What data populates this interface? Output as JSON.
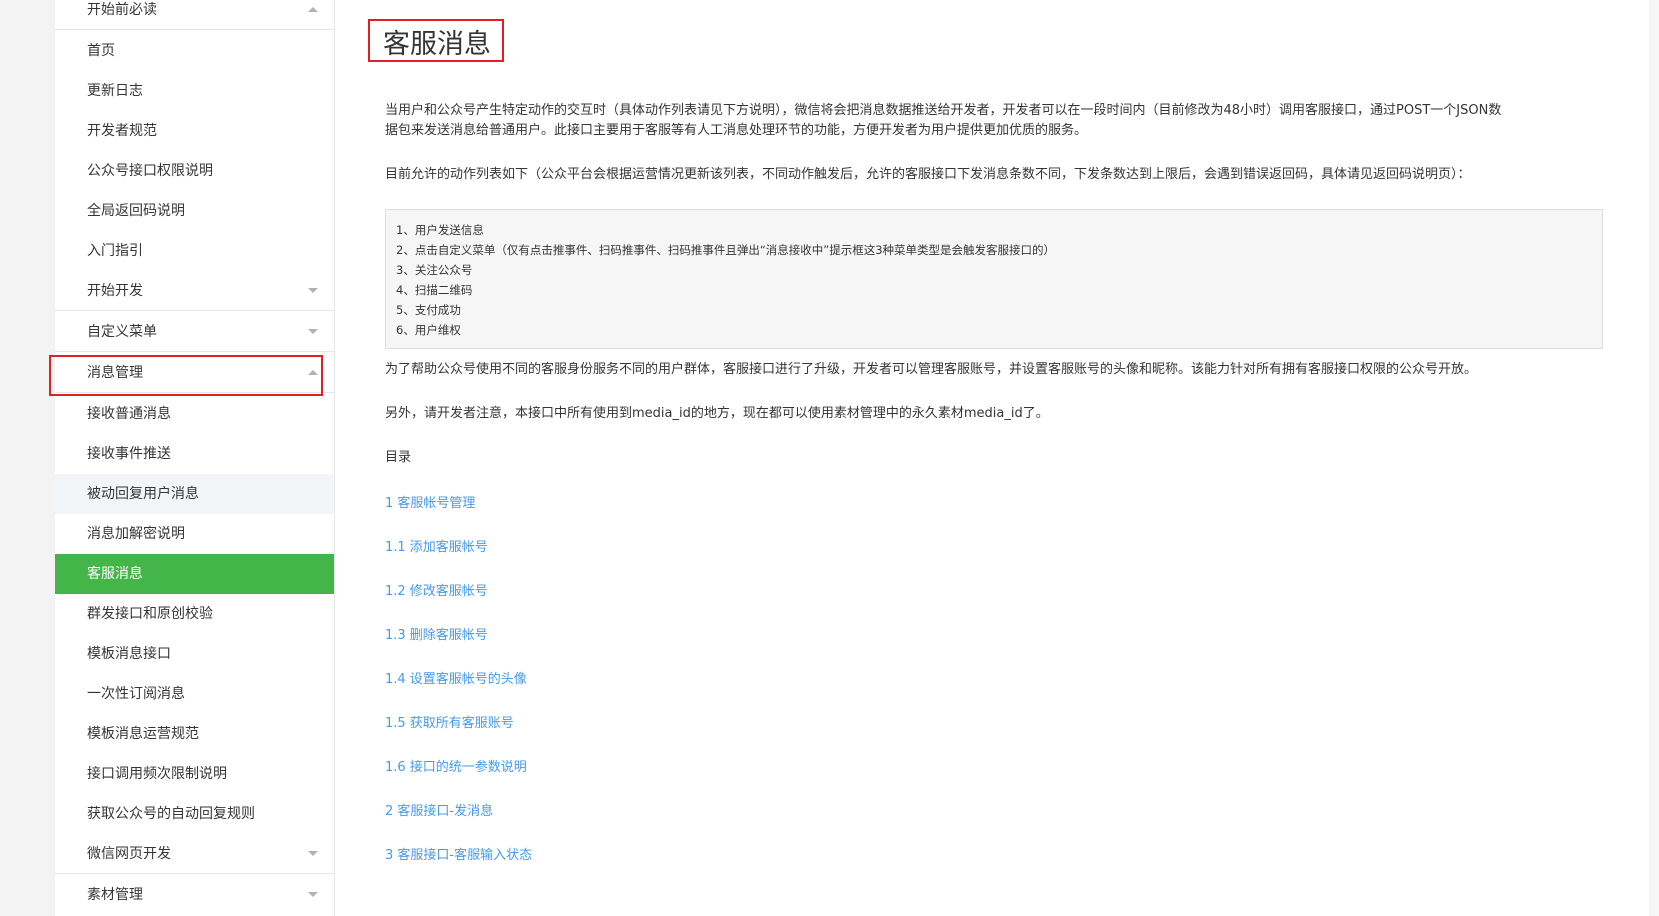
{
  "sidebar": {
    "items": [
      {
        "label": "开始前必读",
        "caret": "up"
      },
      {
        "label": "首页"
      },
      {
        "label": "更新日志"
      },
      {
        "label": "开发者规范"
      },
      {
        "label": "公众号接口权限说明"
      },
      {
        "label": "全局返回码说明"
      },
      {
        "label": "入门指引"
      },
      {
        "label": "开始开发",
        "caret": "down"
      },
      {
        "label": "自定义菜单",
        "caret": "down"
      },
      {
        "label": "消息管理",
        "caret": "up"
      },
      {
        "label": "接收普通消息"
      },
      {
        "label": "接收事件推送"
      },
      {
        "label": "被动回复用户消息"
      },
      {
        "label": "消息加解密说明"
      },
      {
        "label": "客服消息"
      },
      {
        "label": "群发接口和原创校验"
      },
      {
        "label": "模板消息接口"
      },
      {
        "label": "一次性订阅消息"
      },
      {
        "label": "模板消息运营规范"
      },
      {
        "label": "接口调用频次限制说明"
      },
      {
        "label": "获取公众号的自动回复规则"
      },
      {
        "label": "微信网页开发",
        "caret": "down"
      },
      {
        "label": "素材管理",
        "caret": "down"
      }
    ],
    "active_color": "#44b549"
  },
  "main": {
    "title": "客服消息",
    "intro_line1": "当用户和公众号产生特定动作的交互时（具体动作列表请见下方说明），微信将会把消息数据推送给开发者，开发者可以在一段时间内（目前修改为48小时）调用客服接口，通过POST一个JSON数",
    "intro_line2": "据包来发送消息给普通用户。此接口主要用于客服等有人工消息处理环节的功能，方便开发者为用户提供更加优质的服务。",
    "allowed_actions_intro": "目前允许的动作列表如下（公众平台会根据运营情况更新该列表，不同动作触发后，允许的客服接口下发消息条数不同，下发条数达到上限后，会遇到错误返回码，具体请见返回码说明页）：",
    "actions": [
      "1、用户发送信息",
      "2、点击自定义菜单（仅有点击推事件、扫码推事件、扫码推事件且弹出“消息接收中”提示框这3种菜单类型是会触发客服接口的）",
      "3、关注公众号",
      "4、扫描二维码",
      "5、支付成功",
      "6、用户维权"
    ],
    "upgrade_note": "为了帮助公众号使用不同的客服身份服务不同的用户群体，客服接口进行了升级，开发者可以管理客服账号，并设置客服账号的头像和昵称。该能力针对所有拥有客服接口权限的公众号开放。",
    "media_note": "另外，请开发者注意，本接口中所有使用到media_id的地方，现在都可以使用素材管理中的永久素材media_id了。",
    "toc_heading": "目录",
    "toc": [
      "1 客服帐号管理",
      "1.1 添加客服帐号",
      "1.2 修改客服帐号",
      "1.3 删除客服帐号",
      "1.4 设置客服帐号的头像",
      "1.5 获取所有客服账号",
      "1.6 接口的统一参数说明",
      "2 客服接口-发消息",
      "3 客服接口-客服输入状态"
    ],
    "link_color": "#459ae9",
    "annotation_color": "#e02020"
  }
}
